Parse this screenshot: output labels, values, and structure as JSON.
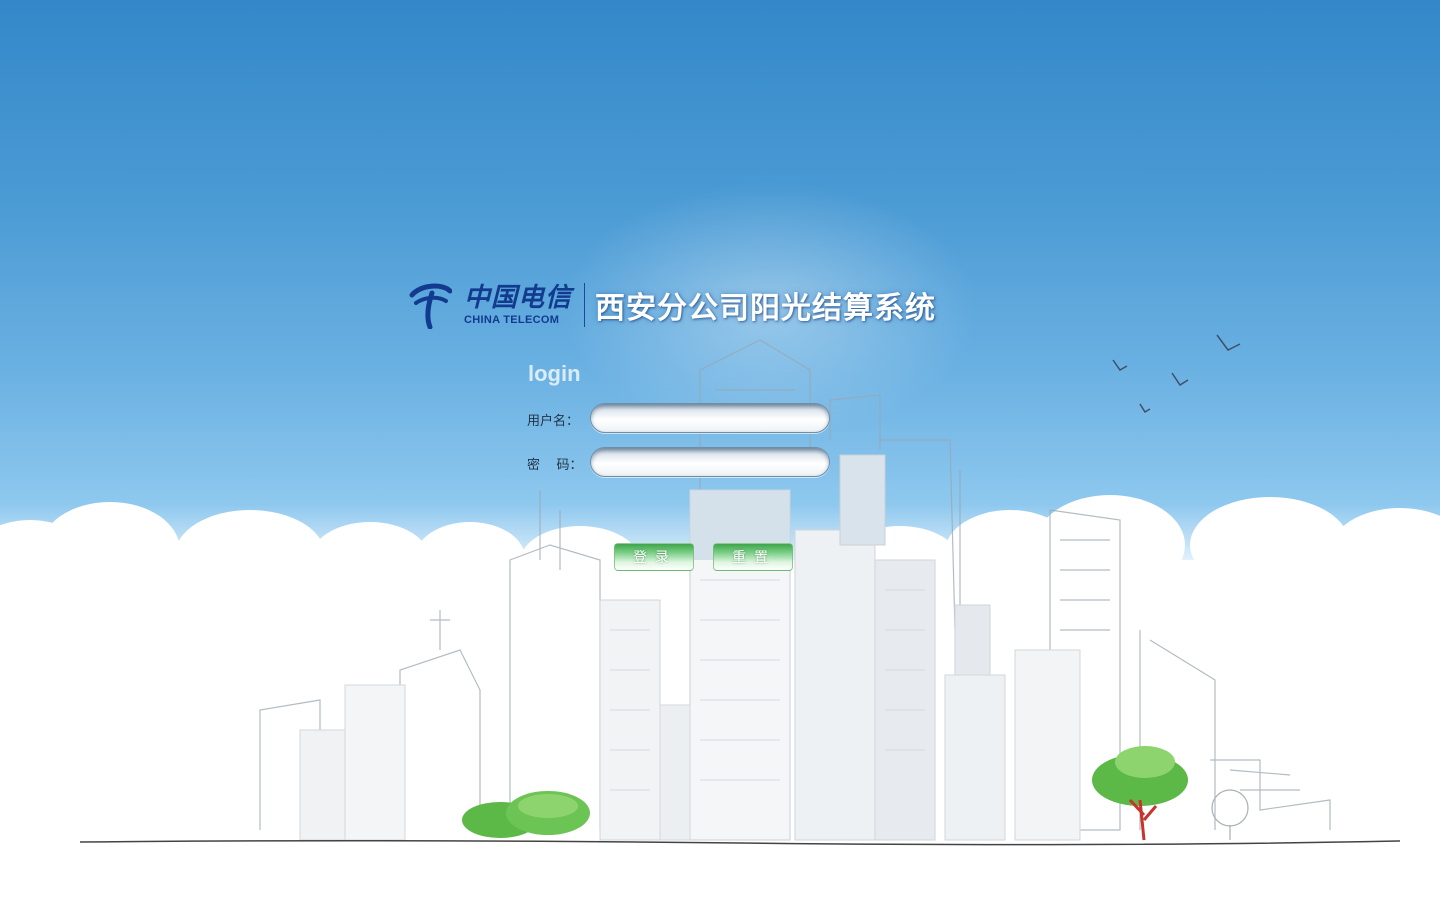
{
  "header": {
    "brand_cn": "中国电信",
    "brand_en": "CHINA TELECOM",
    "system_title": "西安分公司阳光结算系统"
  },
  "form": {
    "heading": "login",
    "username_label": "用户名：",
    "username_value": "",
    "password_label": "密    码：",
    "password_value": "",
    "login_button": "登录",
    "reset_button": "重置"
  },
  "colors": {
    "sky_top": "#3488c9",
    "brand_blue": "#123b8f",
    "button_green": "#3da54a"
  }
}
